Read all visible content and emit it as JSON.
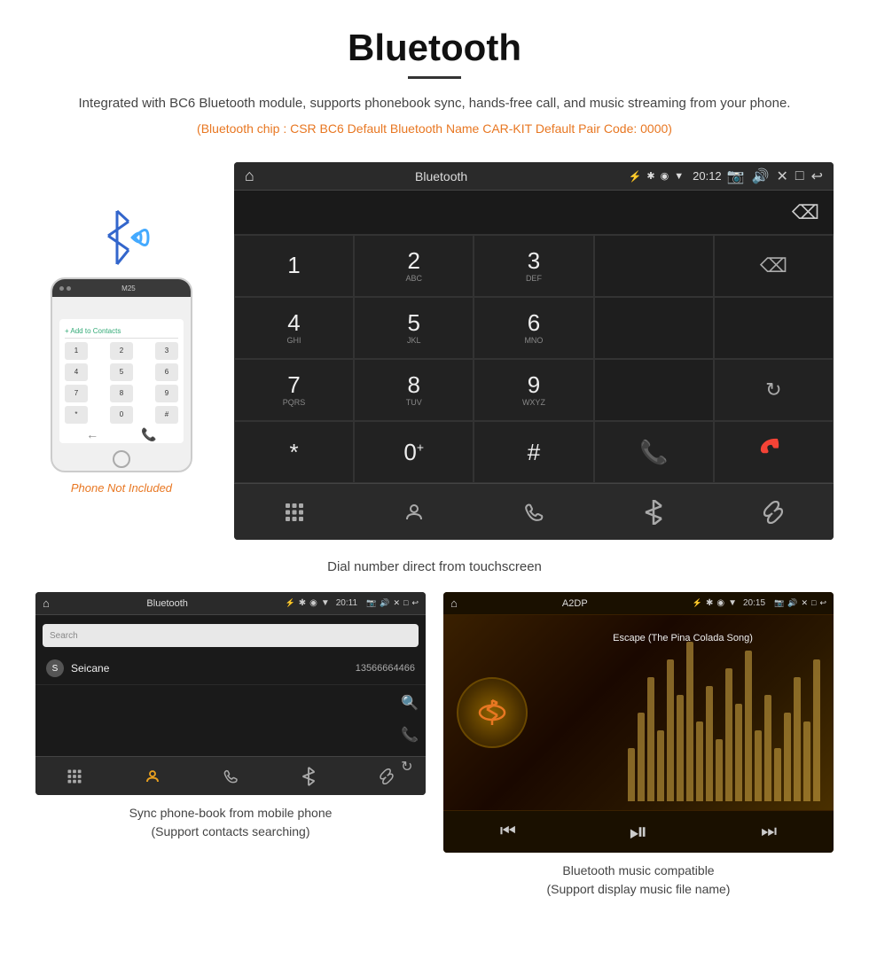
{
  "page": {
    "title": "Bluetooth",
    "subtitle": "Integrated with BC6 Bluetooth module, supports phonebook sync, hands-free call, and music streaming from your phone.",
    "info_line": "(Bluetooth chip : CSR BC6    Default Bluetooth Name CAR-KIT    Default Pair Code: 0000)",
    "dial_caption": "Dial number direct from touchscreen"
  },
  "status_bar": {
    "title": "Bluetooth",
    "time": "20:12",
    "usb_icon": "⚡",
    "bt_icon": "✱",
    "location_icon": "◉",
    "signal_icon": "▼"
  },
  "status_bar_mini_left": {
    "title": "Bluetooth",
    "time": "20:11"
  },
  "status_bar_mini_right": {
    "title": "A2DP",
    "time": "20:15"
  },
  "keypad": {
    "keys": [
      {
        "num": "1",
        "letters": ""
      },
      {
        "num": "2",
        "letters": "ABC"
      },
      {
        "num": "3",
        "letters": "DEF"
      },
      {
        "num": "",
        "letters": ""
      },
      {
        "num": "",
        "letters": ""
      },
      {
        "num": "4",
        "letters": "GHI"
      },
      {
        "num": "5",
        "letters": "JKL"
      },
      {
        "num": "6",
        "letters": "MNO"
      },
      {
        "num": "",
        "letters": ""
      },
      {
        "num": "",
        "letters": ""
      },
      {
        "num": "7",
        "letters": "PQRS"
      },
      {
        "num": "8",
        "letters": "TUV"
      },
      {
        "num": "9",
        "letters": "WXYZ"
      },
      {
        "num": "",
        "letters": ""
      },
      {
        "num": "sync",
        "letters": ""
      },
      {
        "num": "*",
        "letters": ""
      },
      {
        "num": "0",
        "letters": "+"
      },
      {
        "num": "#",
        "letters": ""
      },
      {
        "num": "call_green",
        "letters": ""
      },
      {
        "num": "call_red",
        "letters": ""
      }
    ]
  },
  "bottom_nav": {
    "items": [
      "⊞",
      "👤",
      "📞",
      "✱",
      "🔗"
    ]
  },
  "contacts": {
    "search_placeholder": "Search",
    "contact_name": "Seicane",
    "contact_number": "13566664466",
    "contact_initial": "S"
  },
  "music": {
    "song_title": "Escape (The Pina Colada Song)"
  },
  "labels": {
    "phone_not_included": "Phone Not Included",
    "contacts_caption_line1": "Sync phone-book from mobile phone",
    "contacts_caption_line2": "(Support contacts searching)",
    "music_caption_line1": "Bluetooth music compatible",
    "music_caption_line2": "(Support display music file name)"
  }
}
